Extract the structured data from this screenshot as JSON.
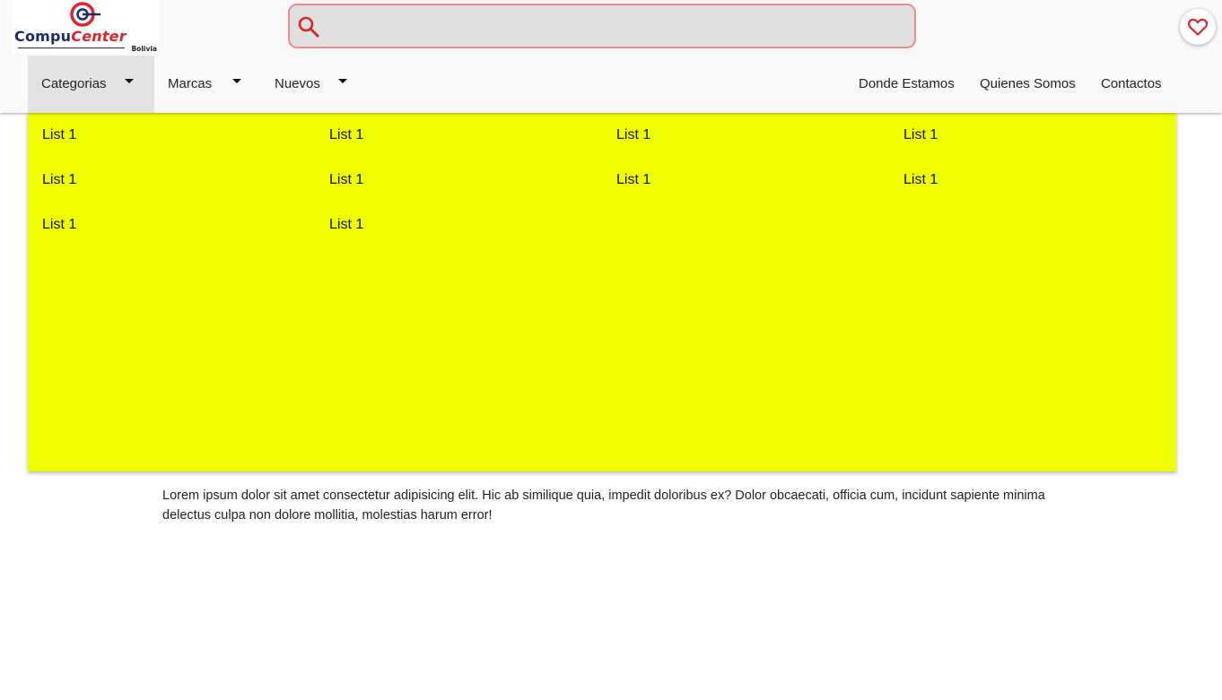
{
  "header": {
    "logo": {
      "word_part1": "Compu",
      "word_part2": "Center",
      "subtitle": "Bolivia",
      "colors": {
        "primary": "#1f2a6b",
        "accent": "#d8262b"
      }
    },
    "search": {
      "placeholder": "",
      "value": "",
      "icon": "search-icon",
      "border_color": "#ef8a8a",
      "icon_color": "#d8262b"
    },
    "favorites": {
      "icon": "heart-icon",
      "color": "#d8262b"
    }
  },
  "nav": {
    "left": [
      {
        "label": "Categorias",
        "has_dropdown": true,
        "active": true
      },
      {
        "label": "Marcas",
        "has_dropdown": true,
        "active": false
      },
      {
        "label": "Nuevos",
        "has_dropdown": true,
        "active": false
      }
    ],
    "right": [
      {
        "label": "Donde Estamos"
      },
      {
        "label": "Quienes Somos"
      },
      {
        "label": "Contactos"
      }
    ]
  },
  "mega_menu": {
    "background": "#f0ff00",
    "columns": [
      [
        "List 1",
        "List 1",
        "List 1"
      ],
      [
        "List 1",
        "List 1",
        "List 1"
      ],
      [
        "List 1",
        "List 1"
      ],
      [
        "List 1",
        "List 1"
      ]
    ]
  },
  "content": {
    "paragraph": "Lorem ipsum dolor sit amet consectetur adipisicing elit. Hic ab similique quia, impedit doloribus ex? Dolor obcaecati, officia cum, incidunt sapiente minima delectus culpa non dolore mollitia, molestias harum error!"
  }
}
